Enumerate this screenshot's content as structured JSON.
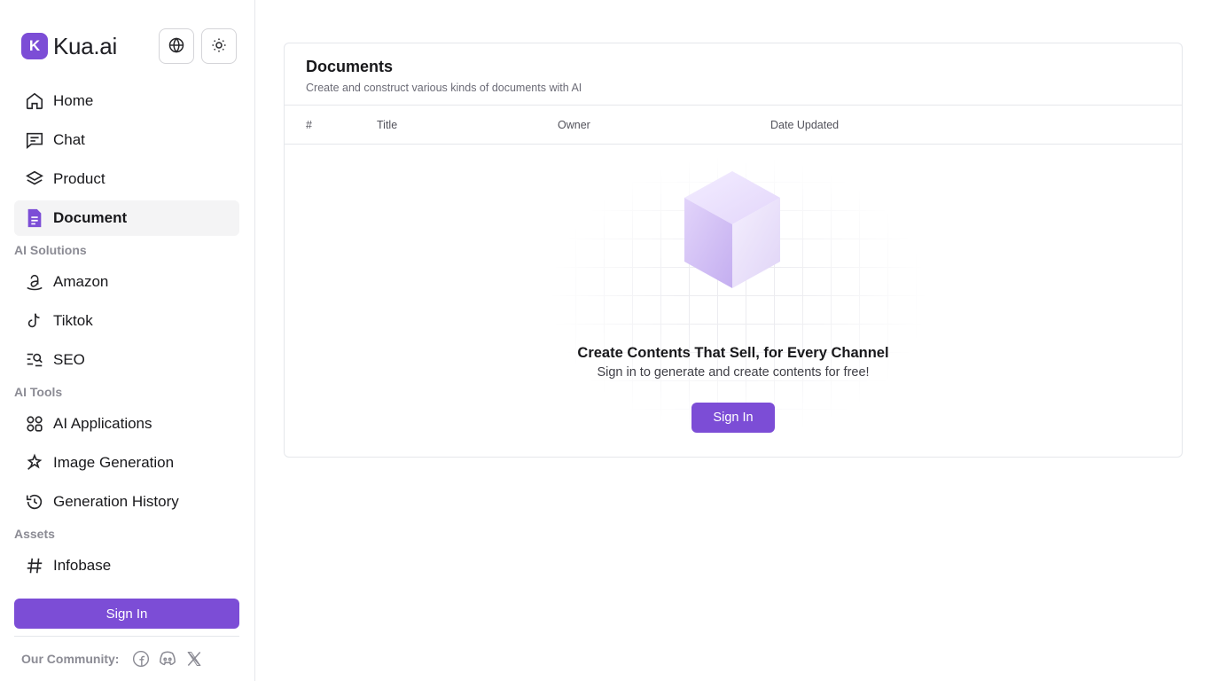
{
  "brand": {
    "name": "Kua.ai",
    "logo_glyph": "K",
    "accent": "#7c4dd6"
  },
  "header_icons": [
    "globe-icon",
    "sun-icon"
  ],
  "nav": {
    "primary": [
      {
        "label": "Home",
        "icon": "home-icon"
      },
      {
        "label": "Chat",
        "icon": "chat-icon"
      },
      {
        "label": "Product",
        "icon": "layers-icon"
      },
      {
        "label": "Document",
        "icon": "document-icon",
        "active": true
      }
    ],
    "ai_solutions": {
      "label": "AI Solutions",
      "items": [
        {
          "label": "Amazon",
          "icon": "amazon-icon"
        },
        {
          "label": "Tiktok",
          "icon": "tiktok-icon"
        },
        {
          "label": "SEO",
          "icon": "seo-icon"
        }
      ]
    },
    "ai_tools": {
      "label": "AI Tools",
      "items": [
        {
          "label": "AI Applications",
          "icon": "apps-icon"
        },
        {
          "label": "Image Generation",
          "icon": "sparkle-icon"
        },
        {
          "label": "Generation History",
          "icon": "history-icon"
        }
      ]
    },
    "assets": {
      "label": "Assets",
      "items": [
        {
          "label": "Infobase",
          "icon": "hash-icon"
        }
      ]
    }
  },
  "sidebar_signin": "Sign In",
  "community": {
    "label": "Our Community:",
    "icons": [
      "facebook-icon",
      "discord-icon",
      "x-icon"
    ]
  },
  "documents": {
    "title": "Documents",
    "subtitle": "Create and construct various kinds of documents with AI",
    "columns": [
      "#",
      "Title",
      "Owner",
      "Date Updated"
    ],
    "empty": {
      "title": "Create Contents That Sell, for Every Channel",
      "subtitle": "Sign in to generate and create contents for free!",
      "button": "Sign In"
    }
  }
}
